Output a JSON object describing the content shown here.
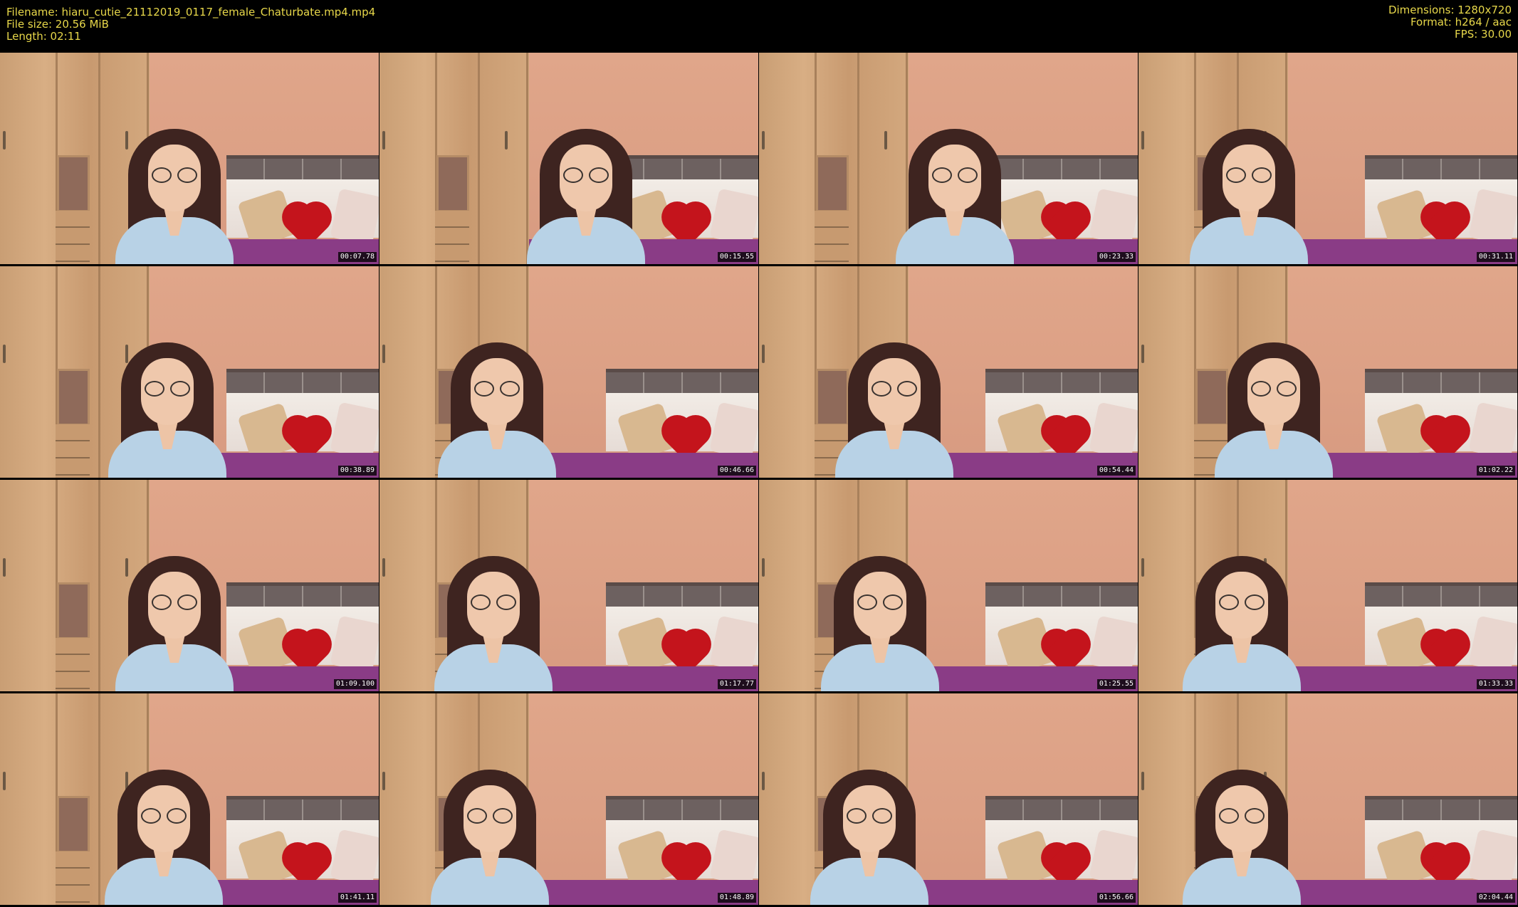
{
  "meta": {
    "filename": "Filename: hiaru_cutie_21112019_0117_female_Chaturbate.mp4.mp4",
    "filesize": "File size: 20.56 MiB",
    "length": "Length: 02:11",
    "dimensions": "Dimensions: 1280x720",
    "format": "Format: h264 / aac",
    "fps": "FPS: 30.00"
  },
  "thumbnails": [
    {
      "timestamp": "00:07.78"
    },
    {
      "timestamp": "00:15.55"
    },
    {
      "timestamp": "00:23.33"
    },
    {
      "timestamp": "00:31.11"
    },
    {
      "timestamp": "00:38.89"
    },
    {
      "timestamp": "00:46.66"
    },
    {
      "timestamp": "00:54.44"
    },
    {
      "timestamp": "01:02.22"
    },
    {
      "timestamp": "01:09.100"
    },
    {
      "timestamp": "01:17.77"
    },
    {
      "timestamp": "01:25.55"
    },
    {
      "timestamp": "01:33.33"
    },
    {
      "timestamp": "01:41.11"
    },
    {
      "timestamp": "01:48.89"
    },
    {
      "timestamp": "01:56.66"
    },
    {
      "timestamp": "02:04.44"
    }
  ]
}
